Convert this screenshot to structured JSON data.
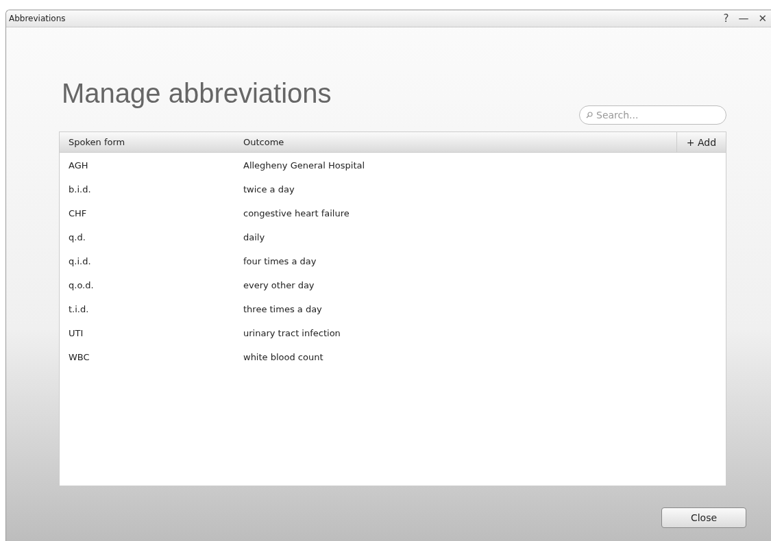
{
  "window": {
    "title": "Abbreviations",
    "controls": [
      "?",
      "—",
      "✕"
    ]
  },
  "heading": "Manage abbreviations",
  "search": {
    "placeholder": "Search..."
  },
  "table": {
    "columns": [
      "Spoken form",
      "Outcome"
    ],
    "add_button": "+ Add",
    "rows": [
      {
        "spoken": "AGH",
        "outcome": "Allegheny General Hospital"
      },
      {
        "spoken": "b.i.d.",
        "outcome": "twice a day"
      },
      {
        "spoken": "CHF",
        "outcome": "congestive heart failure"
      },
      {
        "spoken": "q.d.",
        "outcome": "daily"
      },
      {
        "spoken": "q.i.d.",
        "outcome": "four times a day"
      },
      {
        "spoken": "q.o.d.",
        "outcome": "every other day"
      },
      {
        "spoken": "t.i.d.",
        "outcome": "three times a day"
      },
      {
        "spoken": "UTI",
        "outcome": "urinary tract infection"
      },
      {
        "spoken": "WBC",
        "outcome": "white blood count"
      }
    ]
  },
  "buttons": [
    "Close"
  ]
}
